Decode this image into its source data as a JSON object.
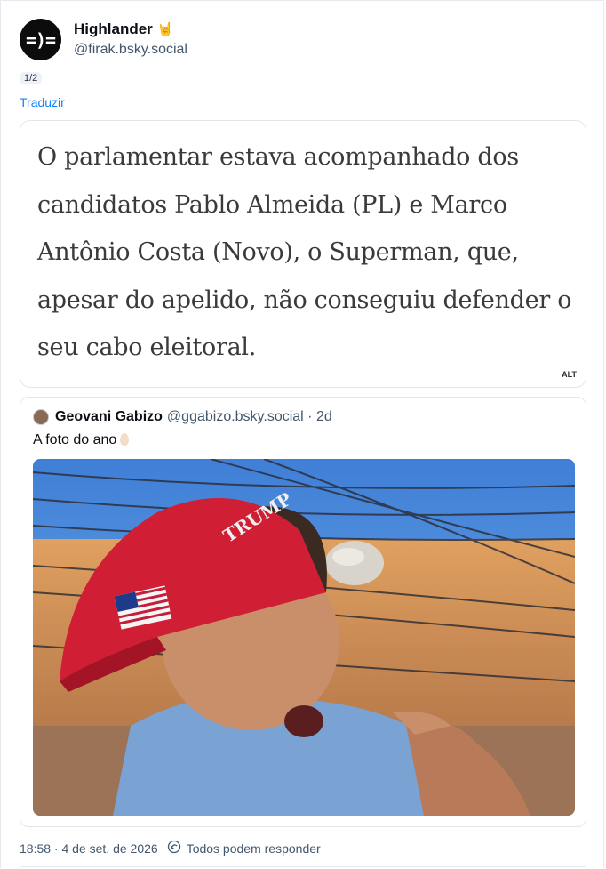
{
  "post": {
    "author": {
      "display_name": "Highlander",
      "emoji": "🤘",
      "handle": "@firak.bsky.social",
      "avatar_text": "=)="
    },
    "thread_badge": "1/2",
    "translate_label": "Traduzir",
    "image_quote_text": "O parlamentar estava acompanhado dos candidatos Pablo Almeida (PL) e Marco Antônio Costa (Novo), o Superman, que, apesar do apelido, não conseguiu defender o seu cabo eleitoral.",
    "alt_label": "ALT",
    "footer": {
      "timestamp": "18:58 · 4 de set. de 2026",
      "reply_setting": "Todos podem responder"
    }
  },
  "embed": {
    "author_name": "Geovani Gabizo",
    "author_handle": "@ggabizo.bsky.social · 2d",
    "text": "A foto do ano",
    "cap_text": "TRUMP"
  },
  "colors": {
    "link": "#1083fe",
    "muted": "#42576c",
    "border": "#e3e7ec"
  }
}
